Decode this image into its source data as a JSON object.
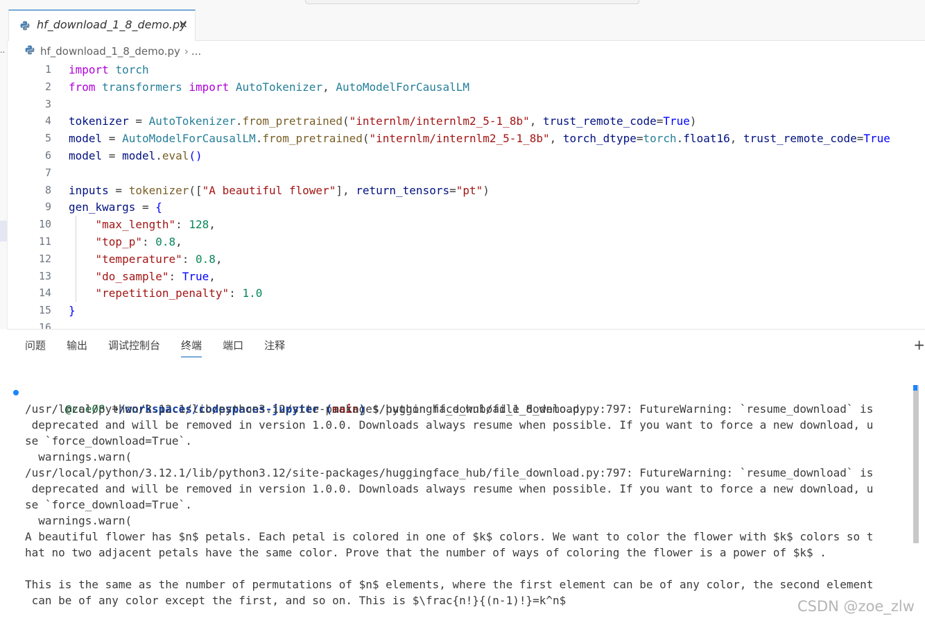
{
  "editor_tab": {
    "title": "hf_download_1_8_demo.py",
    "close_glyph": "×"
  },
  "breadcrumb": {
    "file": "hf_download_1_8_demo.py",
    "sep": "›",
    "more": "..."
  },
  "code_lines": [
    {
      "n": "1",
      "html": "<span class='kw'>import</span> <span class='mod'>torch</span>"
    },
    {
      "n": "2",
      "html": "<span class='kw'>from</span> <span class='mod'>transformers</span> <span class='kw'>import</span> <span class='cls'>AutoTokenizer</span>, <span class='cls'>AutoModelForCausalLM</span>"
    },
    {
      "n": "3",
      "html": ""
    },
    {
      "n": "4",
      "html": "<span class='var'>tokenizer</span> = <span class='cls'>AutoTokenizer</span>.<span class='fn'>from_pretrained</span>(<span class='str'>\"internlm/internlm2_5-1_8b\"</span>, <span class='var'>trust_remote_code</span>=<span class='con'>True</span>)"
    },
    {
      "n": "5",
      "html": "<span class='var'>model</span> = <span class='cls'>AutoModelForCausalLM</span>.<span class='fn'>from_pretrained</span>(<span class='str'>\"internlm/internlm2_5-1_8b\"</span>, <span class='var'>torch_dtype</span>=<span class='mod'>torch</span>.<span class='var'>float16</span>, <span class='var'>trust_remote_code</span>=<span class='con'>True</span>"
    },
    {
      "n": "6",
      "html": "<span class='var'>model</span> = <span class='var'>model</span>.<span class='fn'>eval</span><span class='con'>()</span>"
    },
    {
      "n": "7",
      "html": ""
    },
    {
      "n": "8",
      "html": "<span class='var'>inputs</span> = <span class='fn'>tokenizer</span>([<span class='str'>\"A beautiful flower\"</span>], <span class='var'>return_tensors</span>=<span class='str'>\"pt\"</span>)"
    },
    {
      "n": "9",
      "html": "<span class='var'>gen_kwargs</span> = <span class='con'>{</span>"
    },
    {
      "n": "10",
      "html": "    <span class='str'>\"max_length\"</span>: <span class='num'>128</span>,"
    },
    {
      "n": "11",
      "html": "    <span class='str'>\"top_p\"</span>: <span class='num'>0.8</span>,"
    },
    {
      "n": "12",
      "html": "    <span class='str'>\"temperature\"</span>: <span class='num'>0.8</span>,"
    },
    {
      "n": "13",
      "html": "    <span class='str'>\"do_sample\"</span>: <span class='con'>True</span>,"
    },
    {
      "n": "14",
      "html": "    <span class='str'>\"repetition_penalty\"</span>: <span class='num'>1.0</span>"
    },
    {
      "n": "15",
      "html": "<span class='con'>}</span>"
    },
    {
      "n": "16",
      "html": ""
    }
  ],
  "panel_tabs": [
    {
      "label": "问题",
      "active": false
    },
    {
      "label": "输出",
      "active": false
    },
    {
      "label": "调试控制台",
      "active": false
    },
    {
      "label": "终端",
      "active": true
    },
    {
      "label": "端口",
      "active": false
    },
    {
      "label": "注释",
      "active": false
    }
  ],
  "panel_plus": "+",
  "terminal": {
    "prompt": {
      "user": "@zoe08",
      "arrow": "➜",
      "path": "/workspaces/codespaces-jupyter",
      "branch_open": "(",
      "branch": "main",
      "branch_close": ")",
      "dollar": "$",
      "command": "python hf_download_1_8_demo.py"
    },
    "lines": [
      "/usr/local/python/3.12.1/lib/python3.12/site-packages/huggingface_hub/file_download.py:797: FutureWarning: `resume_download` is",
      " deprecated and will be removed in version 1.0.0. Downloads always resume when possible. If you want to force a new download, u",
      "se `force_download=True`.",
      "  warnings.warn(",
      "/usr/local/python/3.12.1/lib/python3.12/site-packages/huggingface_hub/file_download.py:797: FutureWarning: `resume_download` is",
      " deprecated and will be removed in version 1.0.0. Downloads always resume when possible. If you want to force a new download, u",
      "se `force_download=True`.",
      "  warnings.warn(",
      "A beautiful flower has $n$ petals. Each petal is colored in one of $k$ colors. We want to color the flower with $k$ colors so t",
      "hat no two adjacent petals have the same color. Prove that the number of ways of coloring the flower is a power of $k$ .",
      "",
      "This is the same as the number of permutations of $n$ elements, where the first element can be of any color, the second element",
      " can be of any color except the first, and so on. This is $\\frac{n!}{(n-1)!}=k^n$"
    ]
  },
  "watermark": "CSDN @zoe_zlw",
  "icons": {
    "file": "python-file-icon",
    "close": "close-icon",
    "add": "add-terminal-icon"
  },
  "colors": {
    "accent": "#005fb8",
    "keyword": "#af00db",
    "string": "#a31515",
    "type": "#267f99",
    "number": "#098658"
  }
}
